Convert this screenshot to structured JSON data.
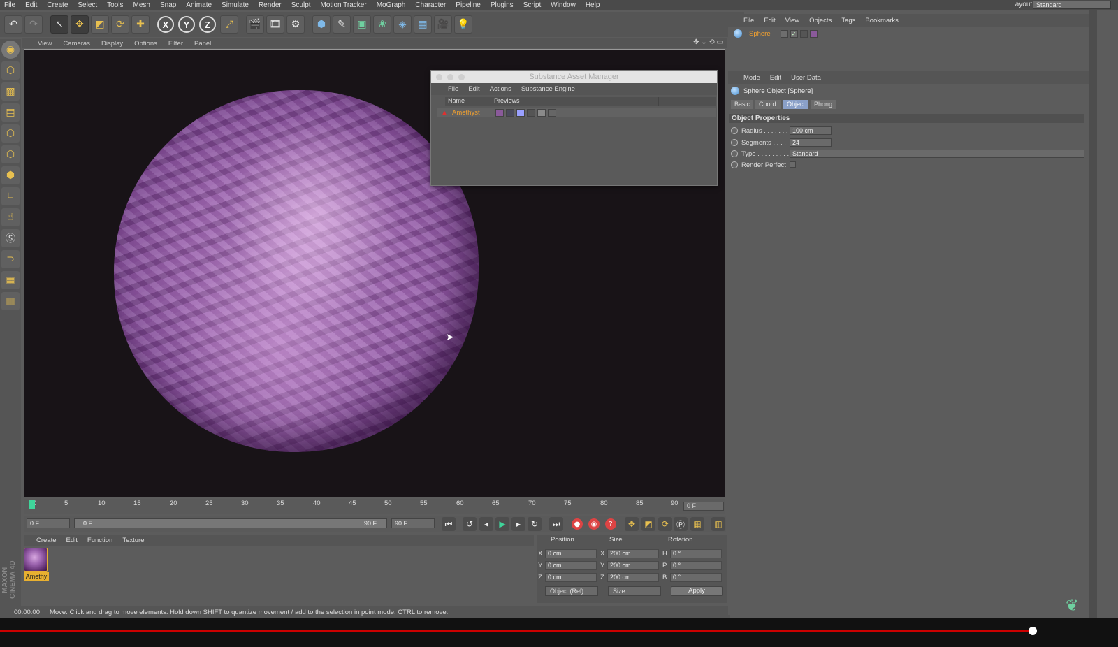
{
  "menubar": [
    "File",
    "Edit",
    "Create",
    "Select",
    "Tools",
    "Mesh",
    "Snap",
    "Animate",
    "Simulate",
    "Render",
    "Sculpt",
    "Motion Tracker",
    "MoGraph",
    "Character",
    "Pipeline",
    "Plugins",
    "Script",
    "Window",
    "Help"
  ],
  "layout": {
    "label": "Layout:",
    "value": "Standard"
  },
  "viewport_menu": [
    "View",
    "Cameras",
    "Display",
    "Options",
    "Filter",
    "Panel"
  ],
  "substance": {
    "title": "Substance Asset Manager",
    "menu": [
      "File",
      "Edit",
      "Actions",
      "Substance Engine"
    ],
    "columns": [
      "Name",
      "Previews"
    ],
    "asset": "Amethyst"
  },
  "timeline": {
    "ticks": [
      "0",
      "5",
      "10",
      "15",
      "20",
      "25",
      "30",
      "35",
      "40",
      "45",
      "50",
      "55",
      "60",
      "65",
      "70",
      "75",
      "80",
      "85",
      "90"
    ],
    "frame_end_display": "0 F",
    "start": "0 F",
    "range_start": "0 F",
    "range_end": "90 F",
    "end": "90 F"
  },
  "material_menu": [
    "Create",
    "Edit",
    "Function",
    "Texture"
  ],
  "material": {
    "name": "Amethy"
  },
  "coords": {
    "headers": [
      "Position",
      "Size",
      "Rotation"
    ],
    "rows": [
      {
        "axis": "X",
        "pos": "0 cm",
        "saxis": "X",
        "size": "200 cm",
        "raxis": "H",
        "rot": "0 °"
      },
      {
        "axis": "Y",
        "pos": "0 cm",
        "saxis": "Y",
        "size": "200 cm",
        "raxis": "P",
        "rot": "0 °"
      },
      {
        "axis": "Z",
        "pos": "0 cm",
        "saxis": "Z",
        "size": "200 cm",
        "raxis": "B",
        "rot": "0 °"
      }
    ],
    "mode": "Object (Rel)",
    "size_mode": "Size",
    "apply": "Apply"
  },
  "status": {
    "time": "00:00:00",
    "message": "Move: Click and drag to move elements. Hold down SHIFT to quantize movement / add to the selection in point mode, CTRL to remove."
  },
  "object_menu": [
    "File",
    "Edit",
    "View",
    "Objects",
    "Tags",
    "Bookmarks"
  ],
  "object": {
    "name": "Sphere"
  },
  "attr_menu": [
    "Mode",
    "Edit",
    "User Data"
  ],
  "attributes": {
    "title": "Sphere Object [Sphere]",
    "tabs": [
      "Basic",
      "Coord.",
      "Object",
      "Phong"
    ],
    "section": "Object Properties",
    "props": [
      {
        "label": "Radius . . . . . . .",
        "value": "100 cm"
      },
      {
        "label": "Segments . . . .",
        "value": "24"
      },
      {
        "label": "Type . . . . . . . . .",
        "value": "Standard"
      },
      {
        "label": "Render Perfect",
        "value": ""
      }
    ]
  },
  "branding": "MAXON CINEMA 4D"
}
